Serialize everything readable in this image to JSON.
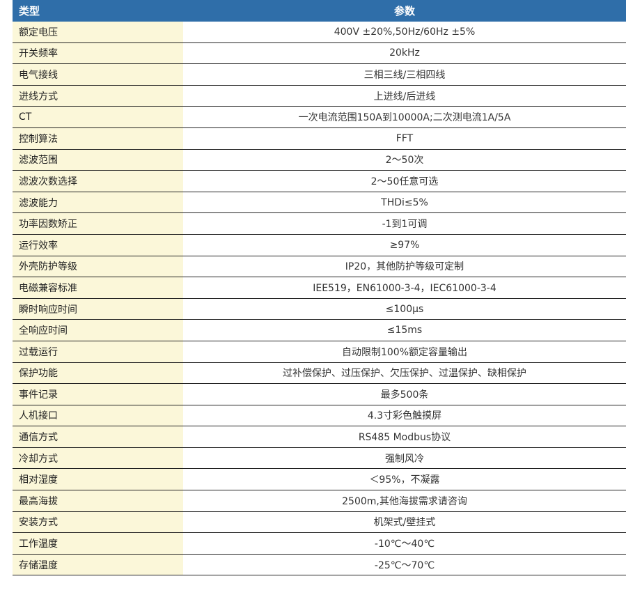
{
  "header": {
    "type_label": "类型",
    "param_label": "参数"
  },
  "rows": [
    {
      "type": "额定电压",
      "value": "400V   ±20%,50Hz/60Hz   ±5%"
    },
    {
      "type": "开关频率",
      "value": "20kHz"
    },
    {
      "type": "电气接线",
      "value": "三相三线/三相四线"
    },
    {
      "type": "进线方式",
      "value": "上进线/后进线"
    },
    {
      "type": "CT",
      "value": "一次电流范围150A到10000A;二次测电流1A/5A"
    },
    {
      "type": "控制算法",
      "value": "FFT"
    },
    {
      "type": "滤波范围",
      "value": "2～50次"
    },
    {
      "type": "滤波次数选择",
      "value": "2～50任意可选"
    },
    {
      "type": "滤波能力",
      "value": "THDi≤5%"
    },
    {
      "type": "功率因数矫正",
      "value": "-1到1可调"
    },
    {
      "type": "运行效率",
      "value": "≥97%"
    },
    {
      "type": "外壳防护等级",
      "value": "IP20，其他防护等级可定制"
    },
    {
      "type": "电磁兼容标准",
      "value": "IEE519，EN61000-3-4，IEC61000-3-4"
    },
    {
      "type": "瞬时响应时间",
      "value": "≤100μs"
    },
    {
      "type": "全响应时间",
      "value": "≤15ms"
    },
    {
      "type": "过载运行",
      "value": "自动限制100%额定容量输出"
    },
    {
      "type": "保护功能",
      "value": "过补偿保护、过压保护、欠压保护、过温保护、缺相保护"
    },
    {
      "type": "事件记录",
      "value": "最多500条"
    },
    {
      "type": "人机接口",
      "value": "4.3寸彩色触摸屏"
    },
    {
      "type": "通信方式",
      "value": "RS485 Modbus协议"
    },
    {
      "type": "冷却方式",
      "value": "强制风冷"
    },
    {
      "type": "相对湿度",
      "value": "＜95%，不凝露"
    },
    {
      "type": "最高海拔",
      "value": "2500m,其他海拔需求请咨询"
    },
    {
      "type": "安装方式",
      "value": "机架式/壁挂式"
    },
    {
      "type": "工作温度",
      "value": "-10℃～40℃"
    },
    {
      "type": "存储温度",
      "value": "-25℃～70℃"
    }
  ],
  "colors": {
    "header_bg": "#2f6ea9",
    "type_col_bg": "#fbf7d9",
    "row_border": "#222222"
  }
}
